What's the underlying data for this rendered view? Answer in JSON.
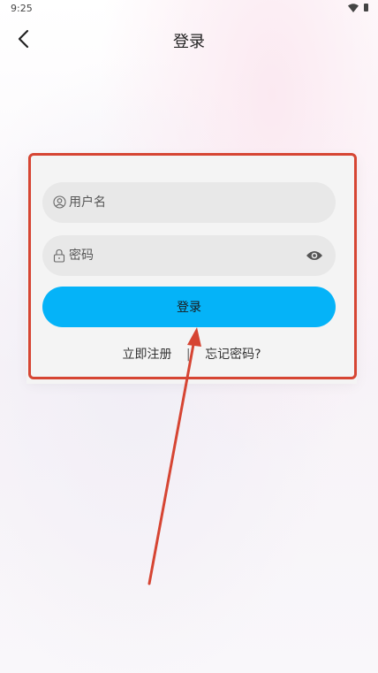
{
  "status_bar": {
    "time": "9:25"
  },
  "header": {
    "title": "登录"
  },
  "form": {
    "username_placeholder": "用户名",
    "password_placeholder": "密码",
    "login_button": "登录",
    "register_link": "立即注册",
    "separator": "|",
    "forgot_link": "忘记密码?"
  },
  "icons": {
    "back": "chevron-left-icon",
    "username": "user-icon",
    "password": "lock-icon",
    "visibility": "eye-icon"
  },
  "colors": {
    "primary_button": "#05b3f8",
    "annotation": "#d64533"
  }
}
